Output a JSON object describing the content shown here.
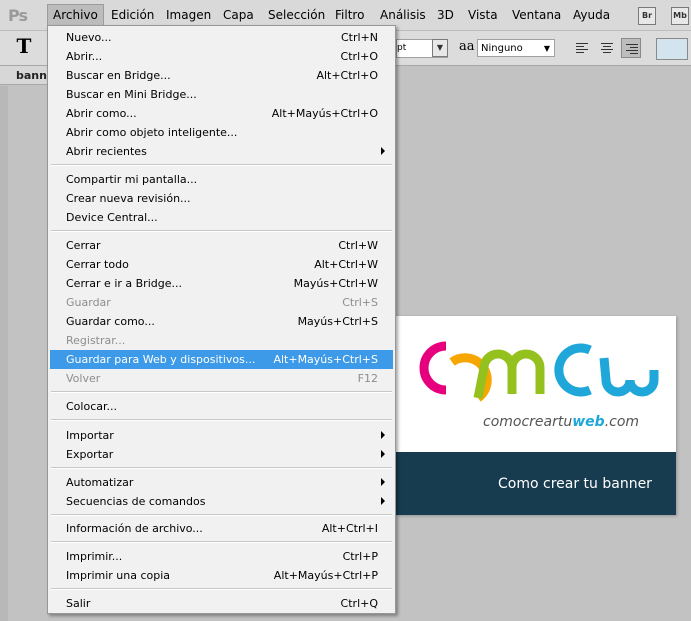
{
  "app": {
    "logo": "Ps"
  },
  "menubar": {
    "items": [
      "Archivo",
      "Edición",
      "Imagen",
      "Capa",
      "Selección",
      "Filtro",
      "Análisis",
      "3D",
      "Vista",
      "Ventana",
      "Ayuda"
    ],
    "bridge_label": "Br",
    "minibridge_label": "Mb"
  },
  "options_bar": {
    "tool_icon": "T",
    "size_value": "pt",
    "aa_icon": "aa",
    "antialias_value": "Ninguno",
    "color_swatch": "#d4e4ee"
  },
  "document_tab": {
    "label": "banne"
  },
  "canvas": {
    "url_prefix": "comocreartu",
    "url_bold": "web",
    "url_suffix": ".com",
    "banner_text": "Como crear tu banner",
    "strip_color": "#173b4f"
  },
  "menu": {
    "items": [
      {
        "label": "Nuevo...",
        "shortcut": "Ctrl+N"
      },
      {
        "label": "Abrir...",
        "shortcut": "Ctrl+O"
      },
      {
        "label": "Buscar en Bridge...",
        "shortcut": "Alt+Ctrl+O"
      },
      {
        "label": "Buscar en Mini Bridge...",
        "shortcut": ""
      },
      {
        "label": "Abrir como...",
        "shortcut": "Alt+Mayús+Ctrl+O"
      },
      {
        "label": "Abrir como objeto inteligente...",
        "shortcut": ""
      },
      {
        "label": "Abrir recientes",
        "shortcut": ""
      },
      {
        "label": "Compartir mi pantalla...",
        "shortcut": ""
      },
      {
        "label": "Crear nueva revisión...",
        "shortcut": ""
      },
      {
        "label": "Device Central...",
        "shortcut": ""
      },
      {
        "label": "Cerrar",
        "shortcut": "Ctrl+W"
      },
      {
        "label": "Cerrar todo",
        "shortcut": "Alt+Ctrl+W"
      },
      {
        "label": "Cerrar e ir a Bridge...",
        "shortcut": "Mayús+Ctrl+W"
      },
      {
        "label": "Guardar",
        "shortcut": "Ctrl+S"
      },
      {
        "label": "Guardar como...",
        "shortcut": "Mayús+Ctrl+S"
      },
      {
        "label": "Registrar...",
        "shortcut": ""
      },
      {
        "label": "Guardar para Web y dispositivos...",
        "shortcut": "Alt+Mayús+Ctrl+S"
      },
      {
        "label": "Volver",
        "shortcut": "F12"
      },
      {
        "label": "Colocar...",
        "shortcut": ""
      },
      {
        "label": "Importar",
        "shortcut": ""
      },
      {
        "label": "Exportar",
        "shortcut": ""
      },
      {
        "label": "Automatizar",
        "shortcut": ""
      },
      {
        "label": "Secuencias de comandos",
        "shortcut": ""
      },
      {
        "label": "Información de archivo...",
        "shortcut": "Alt+Ctrl+I"
      },
      {
        "label": "Imprimir...",
        "shortcut": "Ctrl+P"
      },
      {
        "label": "Imprimir una copia",
        "shortcut": "Alt+Mayús+Ctrl+P"
      },
      {
        "label": "Salir",
        "shortcut": "Ctrl+Q"
      }
    ],
    "highlight_color": "#3d9ae8"
  }
}
